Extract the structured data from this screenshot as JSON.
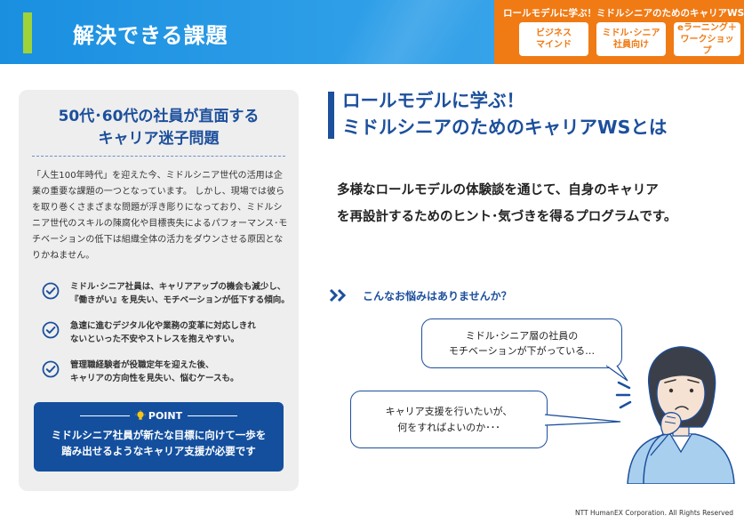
{
  "header": {
    "title": "解決できる課題",
    "program_title": "ロールモデルに学ぶ！ミドルシニアのためのキャリアWS",
    "tags": [
      "ビジネス\nマインド",
      "ミドル･シニア\n社員向け",
      "eラーニング＋\nワークショップ"
    ]
  },
  "left_panel": {
    "title": "50代･60代の社員が直面する\nキャリア迷子問題",
    "body": "「人生100年時代」を迎えた今、ミドルシニア世代の活用は企業の重要な課題の一つとなっています。\nしかし、現場では彼らを取り巻くさまざまな問題が浮き彫りになっており、ミドルシニア世代のスキルの陳腐化や目標喪失によるパフォーマンス･モチベーションの低下は組織全体の活力をダウンさせる原因となりかねません。",
    "checks": [
      "ミドル･シニア社員は、キャリアアップの機会も減少し、\n『働きがい』を見失い、モチベーションが低下する傾向。",
      "急速に進むデジタル化や業務の変革に対応しきれ\nないといった不安やストレスを抱えやすい。",
      "管理職経験者が役職定年を迎えた後、\nキャリアの方向性を見失い、悩むケースも。"
    ],
    "point_label": "POINT",
    "point_text": "ミドルシニア社員が新たな目標に向けて一歩を\n踏み出せるようなキャリア支援が必要です"
  },
  "main": {
    "heading": "ロールモデルに学ぶ！\nミドルシニアのためのキャリアWSとは",
    "description": "多様なロールモデルの体験談を通じて、自身のキャリア\nを再設計するためのヒント･気づきを得るプログラムです。",
    "worry_label": "こんなお悩みはありませんか？",
    "bubbles": [
      "ミドル･シニア層の社員の\nモチベーションが下がっている…",
      "キャリア支援を行いたいが、\n何をすればよいのか･･･"
    ]
  },
  "footer": {
    "copyright": "NTT HumanEX Corporation. All Rights Reserved"
  },
  "colors": {
    "header_blue": "#1a8fe0",
    "accent_green": "#9fd33a",
    "orange": "#f07a14",
    "navy": "#1c4f9c",
    "point_blue": "#144f9e",
    "panel_gray": "#eeeeee"
  },
  "icons": [
    "check-circle-icon",
    "lightbulb-icon",
    "double-chevron-icon",
    "thinking-person-illustration"
  ]
}
